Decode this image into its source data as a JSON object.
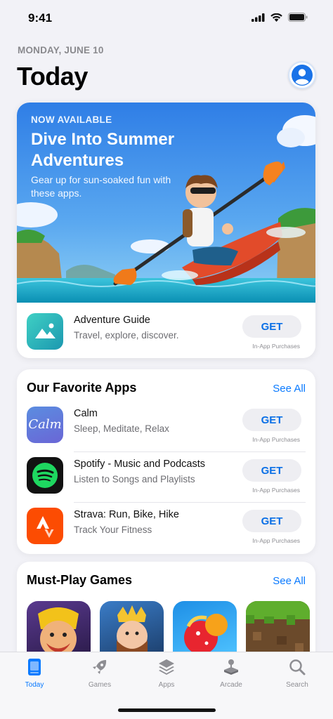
{
  "status_bar": {
    "time": "9:41"
  },
  "header": {
    "date": "MONDAY, JUNE 10",
    "title": "Today"
  },
  "feature": {
    "eyebrow": "NOW AVAILABLE",
    "headline": "Dive Into Summer Adventures",
    "subtitle": "Gear up for sun-soaked fun with these apps.",
    "app": {
      "name": "Adventure Guide",
      "description": "Travel, explore, discover.",
      "button": "GET",
      "note": "In-App Purchases",
      "icon": "mountain-photo-icon"
    }
  },
  "favorites": {
    "title": "Our Favorite Apps",
    "see_all": "See All",
    "apps": [
      {
        "name": "Calm",
        "description": "Sleep, Meditate, Relax",
        "button": "GET",
        "note": "In-App Purchases",
        "icon_text": "Calm"
      },
      {
        "name": "Spotify - Music and Podcasts",
        "description": "Listen to Songs and Playlists",
        "button": "GET",
        "note": "In-App Purchases",
        "icon": "spotify-icon"
      },
      {
        "name": "Strava: Run, Bike, Hike",
        "description": "Track Your Fitness",
        "button": "GET",
        "note": "In-App Purchases",
        "icon": "strava-icon"
      }
    ]
  },
  "games": {
    "title": "Must-Play Games",
    "see_all": "See All",
    "items": [
      "clash-barbarian-icon",
      "king-character-icon",
      "candy-icon",
      "grass-block-icon"
    ]
  },
  "tabs": [
    {
      "label": "Today",
      "icon": "today-icon",
      "active": true
    },
    {
      "label": "Games",
      "icon": "rocket-icon",
      "active": false
    },
    {
      "label": "Apps",
      "icon": "layers-icon",
      "active": false
    },
    {
      "label": "Arcade",
      "icon": "joystick-icon",
      "active": false
    },
    {
      "label": "Search",
      "icon": "search-icon",
      "active": false
    }
  ],
  "colors": {
    "accent": "#0a7aff",
    "background": "#f2f2f7",
    "get_button": "#eeeef2"
  }
}
